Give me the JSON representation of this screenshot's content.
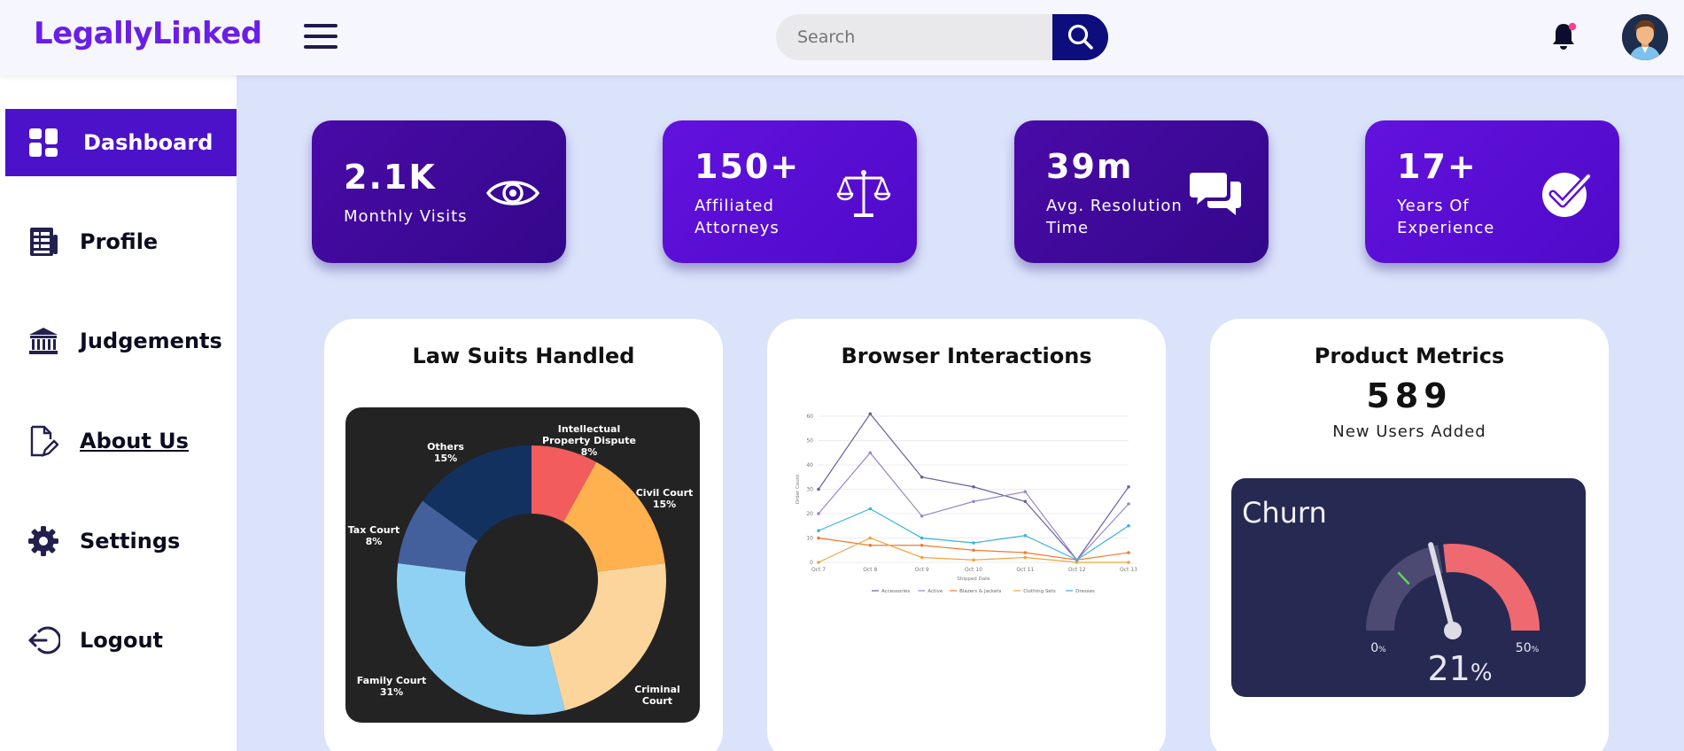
{
  "header": {
    "brand": "LegallyLinked",
    "search_placeholder": "Search"
  },
  "sidebar": {
    "items": [
      {
        "label": "Dashboard",
        "icon": "dashboard-icon"
      },
      {
        "label": "Profile",
        "icon": "document-list-icon"
      },
      {
        "label": "Judgements",
        "icon": "courthouse-icon"
      },
      {
        "label": "About Us",
        "icon": "edit-document-icon"
      },
      {
        "label": "Settings",
        "icon": "gear-icon"
      },
      {
        "label": "Logout",
        "icon": "logout-icon"
      }
    ]
  },
  "stats": [
    {
      "value": "2.1K",
      "label": "Monthly Visits",
      "icon": "eye-icon"
    },
    {
      "value": "150+",
      "label_lines": [
        "Affiliated",
        "Attorneys"
      ],
      "icon": "scales-icon"
    },
    {
      "value": "39m",
      "label_lines": [
        "Avg. Resolution",
        "Time"
      ],
      "icon": "chat-icon"
    },
    {
      "value": "17+",
      "label_lines": [
        "Years Of",
        "Experience"
      ],
      "icon": "checkmark-icon"
    }
  ],
  "colors": {
    "brand": "#6a1ee6",
    "card_dark": "#3f0a9a",
    "card_bright": "#5a0fd8",
    "active_nav": "#4b12c9",
    "search_button": "#0d0d7e"
  },
  "panels": {
    "lawsuits": {
      "title": "Law Suits Handled"
    },
    "browser": {
      "title": "Browser Interactions"
    },
    "product": {
      "title": "Product Metrics",
      "value": "589",
      "subtitle": "New Users Added",
      "churn_title": "Churn"
    }
  },
  "chart_data": [
    {
      "type": "pie",
      "title": "Law Suits Handled",
      "donut": true,
      "slices": [
        {
          "name": "Intellectual Property Dispute",
          "value": 8,
          "label_lines": [
            "Intellectual",
            "Property Dispute",
            "8%"
          ],
          "color": "#f25c5c"
        },
        {
          "name": "Civil Court",
          "value": 15,
          "label_lines": [
            "Civil Court",
            "15%"
          ],
          "color": "#ffb04f"
        },
        {
          "name": "Criminal Court",
          "value": 23,
          "label_lines": [
            "Criminal",
            "Court"
          ],
          "color": "#fbd59b"
        },
        {
          "name": "Family Court",
          "value": 31,
          "label_lines": [
            "Family Court",
            "31%"
          ],
          "color": "#8fd1f3"
        },
        {
          "name": "Tax Court",
          "value": 8,
          "label_lines": [
            "Tax Court",
            "8%"
          ],
          "color": "#43609c"
        },
        {
          "name": "Others",
          "value": 15,
          "label_lines": [
            "Others",
            "15%"
          ],
          "color": "#13315f"
        }
      ]
    },
    {
      "type": "line",
      "title": "Browser Interactions",
      "xlabel": "Shipped Date",
      "ylabel": "Order Count",
      "categories": [
        "Oct 7",
        "Oct 8",
        "Oct 9",
        "Oct 10",
        "Oct 11",
        "Oct 12",
        "Oct 13"
      ],
      "yticks": [
        0,
        10,
        20,
        30,
        40,
        50,
        60
      ],
      "ylim": [
        0,
        60
      ],
      "series": [
        {
          "name": "Accessories",
          "color": "#6a5f9c",
          "values": [
            30,
            61,
            35,
            31,
            25,
            1,
            31
          ]
        },
        {
          "name": "Active",
          "color": "#9a86c8",
          "values": [
            20,
            45,
            19,
            25,
            29,
            1,
            24
          ]
        },
        {
          "name": "Blazers & Jackets",
          "color": "#f07a2e",
          "values": [
            10,
            7,
            7,
            5,
            4,
            1,
            4
          ]
        },
        {
          "name": "Clothing Sets",
          "color": "#f2a23c",
          "values": [
            0,
            10,
            2,
            1,
            2,
            0,
            0
          ]
        },
        {
          "name": "Dresses",
          "color": "#37b4dc",
          "values": [
            13,
            22,
            10,
            8,
            11,
            1,
            15
          ]
        }
      ]
    },
    {
      "type": "gauge",
      "title": "Churn",
      "value": 21,
      "min": 0,
      "max": 50,
      "value_text": "21",
      "unit": "%",
      "min_label": "0",
      "max_label": "50",
      "marker_value": 13
    }
  ]
}
